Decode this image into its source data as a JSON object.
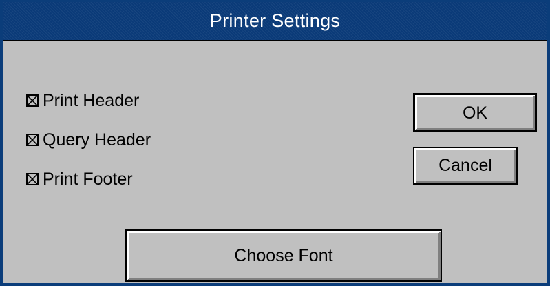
{
  "window": {
    "title": "Printer Settings"
  },
  "options": [
    {
      "label": "Print Header",
      "checked": true
    },
    {
      "label": "Query Header",
      "checked": true
    },
    {
      "label": "Print Footer",
      "checked": true
    }
  ],
  "buttons": {
    "ok_label": "OK",
    "cancel_label": "Cancel",
    "choose_font_label": "Choose Font"
  },
  "colors": {
    "titlebar": "#0a3a78",
    "face": "#c0c0c0",
    "text": "#000000",
    "title_text": "#ffffff"
  }
}
